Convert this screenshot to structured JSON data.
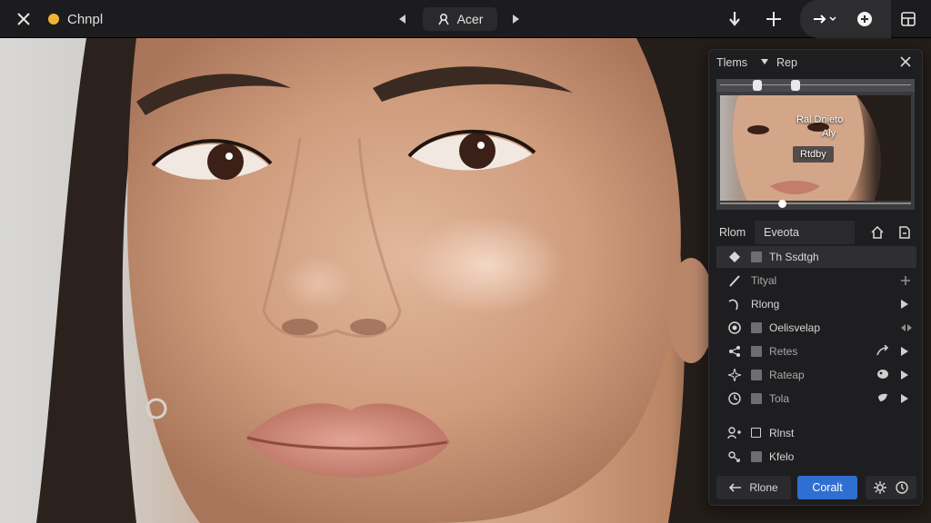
{
  "topbar": {
    "doc_title": "Chnpl",
    "center_label": "Acer",
    "status_dot_color": "#f2b233",
    "icons": [
      "close-icon",
      "chevron-left-icon",
      "person-icon",
      "chevron-right-icon",
      "download-icon",
      "plus-icon",
      "arrow-menu-icon",
      "add-circle-icon",
      "layout-icon"
    ]
  },
  "panel": {
    "title": "Tlems",
    "subtitle": "Rep",
    "preview": {
      "overlay_line1": "Ral Dnieto",
      "overlay_line2": "Aly",
      "overlay_badge": "Rtdby"
    },
    "tabs": [
      "Rlom",
      "Eveota"
    ],
    "rows": [
      {
        "label": "Th Ssdtgh",
        "icon": "diamond-icon",
        "checkbox": true,
        "right_a": "",
        "right_b": "",
        "selected": true
      },
      {
        "label": "Tityal",
        "icon": "brush-icon",
        "checkbox": false,
        "right_a": "",
        "right_b": "cross-icon",
        "selected": false,
        "dim": true
      },
      {
        "label": "Rlong",
        "icon": "curve-icon",
        "checkbox": false,
        "right_a": "",
        "right_b": "play-icon",
        "selected": false
      },
      {
        "label": "Oelisvelap",
        "icon": "target-icon",
        "checkbox": true,
        "right_a": "",
        "right_b": "split-icon",
        "selected": false
      },
      {
        "label": "Retes",
        "icon": "share-icon",
        "checkbox": true,
        "right_a": "arrow-icon",
        "right_b": "play-icon",
        "selected": false,
        "dim": true
      },
      {
        "label": "Rateap",
        "icon": "sparkle-icon",
        "checkbox": true,
        "right_a": "palette-icon",
        "right_b": "play-icon",
        "selected": false,
        "dim": true
      },
      {
        "label": "Tola",
        "icon": "clock-icon",
        "checkbox": true,
        "right_a": "drop-icon",
        "right_b": "play-icon",
        "selected": false,
        "dim": true
      },
      {
        "label": "Rlnst",
        "icon": "people-icon",
        "checkbox": false,
        "right_a": "",
        "right_b": "",
        "selected": false
      },
      {
        "label": "Kfelo",
        "icon": "link-icon",
        "checkbox": true,
        "right_a": "",
        "right_b": "",
        "selected": false
      }
    ],
    "footer": {
      "back_label": "Rlone",
      "primary_label": "Coralt",
      "primary_color": "#2f6fd1"
    }
  }
}
